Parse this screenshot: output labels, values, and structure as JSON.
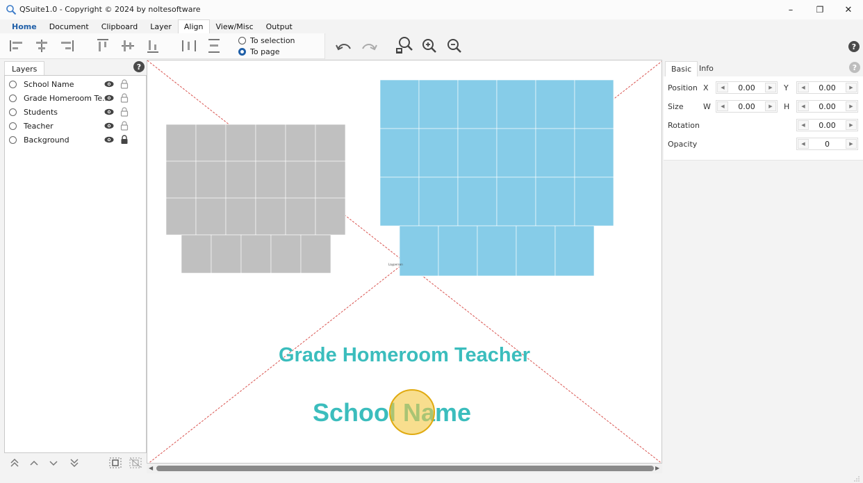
{
  "window": {
    "title": "QSuite1.0 - Copyright © 2024 by noltesoftware",
    "minimize": "–",
    "restore": "❐",
    "close": "✕"
  },
  "menu_tabs": [
    "Home",
    "Document",
    "Clipboard",
    "Layer",
    "Align",
    "View/Misc",
    "Output"
  ],
  "align_target": {
    "option1": "To selection",
    "option2": "To page",
    "selected": "To page"
  },
  "layers_panel": {
    "title": "Layers",
    "items": [
      {
        "name": "School Name",
        "visible": true,
        "locked": false
      },
      {
        "name": "Grade Homeroom Te...",
        "visible": true,
        "locked": false
      },
      {
        "name": "Students",
        "visible": true,
        "locked": false
      },
      {
        "name": "Teacher",
        "visible": true,
        "locked": false
      },
      {
        "name": "Background",
        "visible": true,
        "locked": true
      }
    ]
  },
  "canvas": {
    "grade_text": "Grade Homeroom Teacher",
    "school_text": "School Name",
    "tiny_text": "Layperson",
    "colors": {
      "text": "#3bbdbd",
      "gray_photos": "#c0c0c0",
      "blue_photos": "#86cce8",
      "guide": "#d9534f"
    }
  },
  "properties_panel": {
    "tabs": [
      "Basic",
      "Info"
    ],
    "position_label": "Position",
    "x_label": "X",
    "x_value": "0.00",
    "y_label": "Y",
    "y_value": "0.00",
    "size_label": "Size",
    "w_label": "W",
    "w_value": "0.00",
    "h_label": "H",
    "h_value": "0.00",
    "rotation_label": "Rotation",
    "rotation_value": "0.00",
    "opacity_label": "Opacity",
    "opacity_value": "0"
  },
  "help_glyph": "?"
}
